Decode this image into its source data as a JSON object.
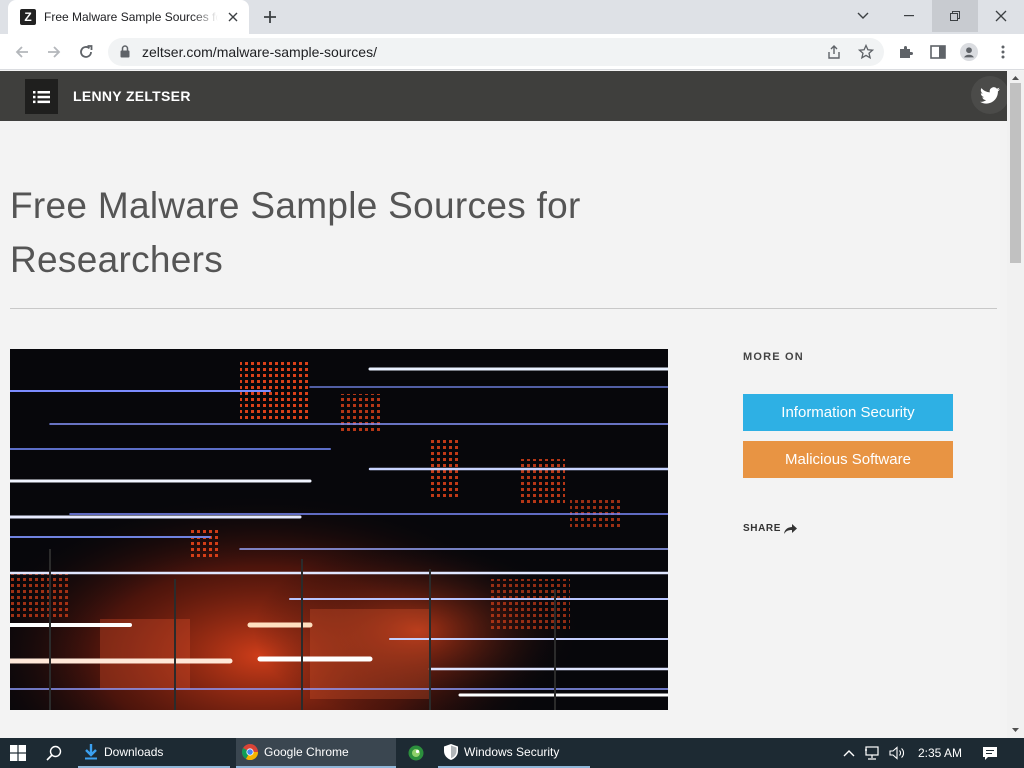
{
  "browser": {
    "tab_title": "Free Malware Sample Sources for Researchers",
    "favicon_letter": "Z",
    "url": "zeltser.com/malware-sample-sources/"
  },
  "site": {
    "name": "LENNY ZELTSER"
  },
  "article": {
    "title": "Free Malware Sample Sources for Researchers"
  },
  "sidebar": {
    "more_on_label": "MORE ON",
    "categories": [
      {
        "label": "Information Security",
        "color": "#2eb0e4"
      },
      {
        "label": "Malicious Software",
        "color": "#e89443"
      }
    ],
    "share_label": "SHARE"
  },
  "taskbar": {
    "apps": [
      {
        "label": "Downloads",
        "icon": "download-folder-icon"
      },
      {
        "label": "Google Chrome",
        "icon": "chrome-icon"
      },
      {
        "label": "",
        "icon": "app-icon"
      },
      {
        "label": "Windows Security",
        "icon": "shield-icon"
      }
    ],
    "time": "2:35 AM"
  },
  "colors": {
    "site_header": "#3f3f3d",
    "info_security": "#2eb0e4",
    "malicious_software": "#e89443"
  }
}
